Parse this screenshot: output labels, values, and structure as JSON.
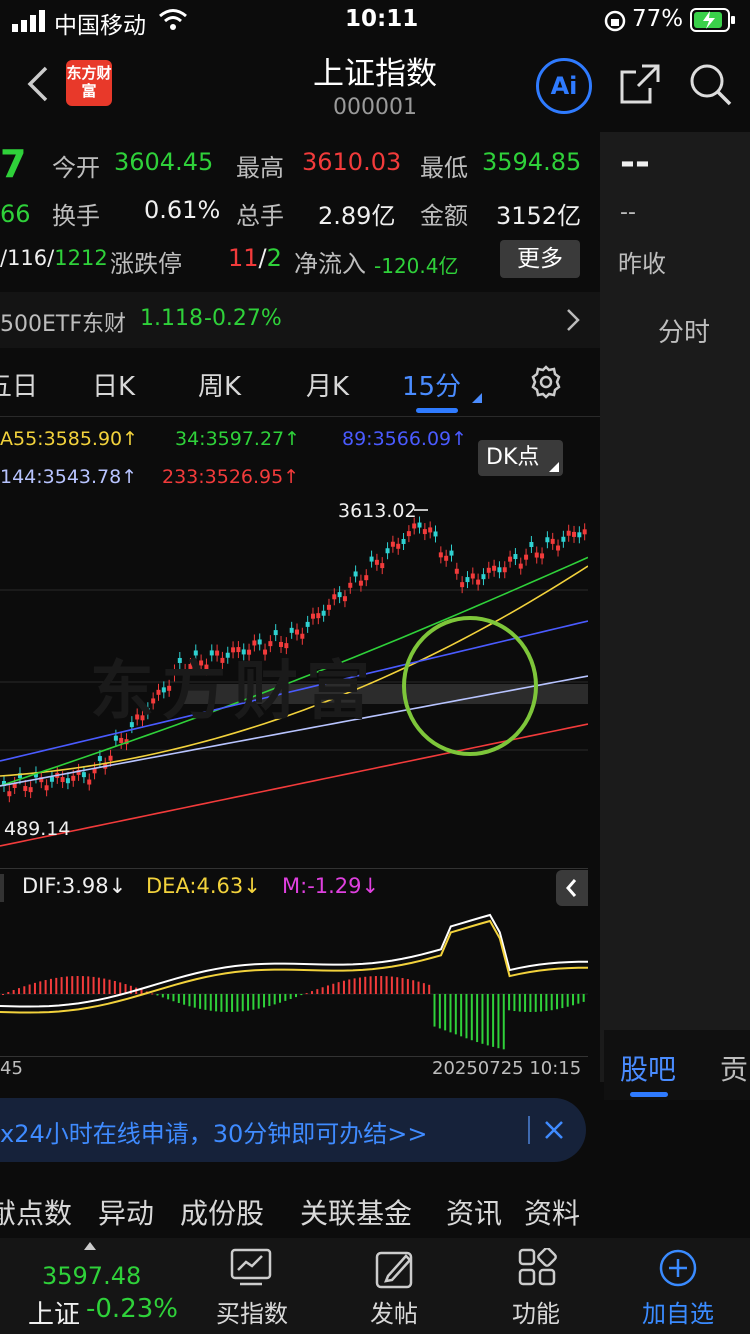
{
  "status_bar": {
    "carrier": "中国移动",
    "time": "10:11",
    "battery": "77%"
  },
  "header": {
    "title": "上证指数",
    "code": "000001",
    "logo_text": "东方财富",
    "ai_label": "Ai",
    "back_icon": "chevron-left-icon",
    "share_icon": "share-icon",
    "search_icon": "search-icon"
  },
  "quote": {
    "price_partial": "7",
    "change_partial": "66",
    "open_label": "今开",
    "open_value": "3604.45",
    "high_label": "最高",
    "high_value": "3610.03",
    "low_label": "最低",
    "low_value": "3594.85",
    "turnover_label": "换手",
    "turnover_value": "0.61%",
    "volume_label": "总手",
    "volume_value": "2.89亿",
    "amount_label": "金额",
    "amount_value": "3152亿",
    "updown_prefix": "/116/",
    "updown_value": "1212",
    "limit_label": "涨跌停",
    "limit_up": "11",
    "limit_sep": "/",
    "limit_down": "2",
    "netflow_label": "净流入",
    "netflow_value": "-120.4亿",
    "more_button": "更多",
    "right_dash1": "--",
    "right_dash2": "--",
    "prev_close_label": "昨收"
  },
  "etf": {
    "name": "500ETF东财",
    "price": "1.118",
    "change": "-0.27%"
  },
  "tabs": [
    {
      "label": "五日",
      "active": false
    },
    {
      "label": "日K",
      "active": false
    },
    {
      "label": "周K",
      "active": false
    },
    {
      "label": "月K",
      "active": false
    },
    {
      "label": "15分",
      "active": true
    }
  ],
  "side_tab": "分时",
  "ma_legend": [
    {
      "text": "A55:3585.90↑",
      "color": "#f2d23c"
    },
    {
      "text": "34:3597.27↑",
      "color": "#2fd13a"
    },
    {
      "text": "89:3566.09↑",
      "color": "#4a5bff"
    },
    {
      "text": "144:3543.78↑",
      "color": "#b8c4ff"
    },
    {
      "text": "233:3526.95↑",
      "color": "#f23b3b"
    }
  ],
  "dk_button": "DK点",
  "chart_labels": {
    "high_marker": "3613.02",
    "low_marker": "489.14",
    "watermark": "东方财富"
  },
  "macd": {
    "dif": "DIF:3.98↓",
    "dea": "DEA:4.63↓",
    "m": "M:-1.29↓"
  },
  "axis": {
    "left_date": "45",
    "right_date": "20250725 10:15"
  },
  "side_panel": {
    "tab1": "股吧",
    "tab2": "贡"
  },
  "banner": {
    "text": "x24小时在线申请，30分钟即可办结>>"
  },
  "bottom_tabs": [
    "献点数",
    "异动",
    "成份股",
    "关联基金",
    "资讯",
    "资料"
  ],
  "nav": {
    "index_price": "3597.48",
    "index_name": "上证",
    "index_change": "-0.23%",
    "buy_index": "买指数",
    "post": "发帖",
    "functions": "功能",
    "add_fav": "加自选"
  },
  "colors": {
    "up": "#f23b3b",
    "down": "#2fd13a",
    "accent": "#2f7bff",
    "background": "#0c0c0c"
  },
  "chart_data": {
    "type": "candlestick",
    "series": [
      {
        "name": "A55",
        "values": [
          3585.9
        ]
      },
      {
        "name": "34",
        "values": [
          3597.27
        ]
      },
      {
        "name": "89",
        "values": [
          3566.09
        ]
      },
      {
        "name": "144",
        "values": [
          3543.78
        ]
      },
      {
        "name": "233",
        "values": [
          3526.95
        ]
      }
    ],
    "annotations": [
      "3613.02",
      "489.14"
    ],
    "grid": true
  }
}
